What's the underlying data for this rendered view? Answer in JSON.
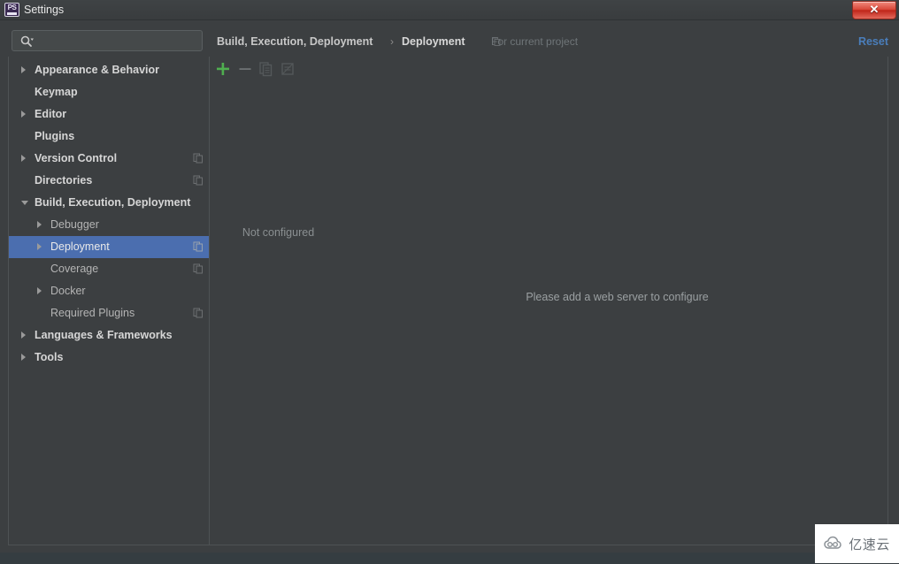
{
  "window": {
    "title": "Settings",
    "app_icon": "phpstorm-icon",
    "app_icon_text": "PS",
    "close_label": "✕"
  },
  "search": {
    "value": "",
    "placeholder": "",
    "icon": "search-icon"
  },
  "sidebar": {
    "items": [
      {
        "label": "Appearance & Behavior",
        "level": 0,
        "arrow": "right",
        "scope_icon": false,
        "selected": false
      },
      {
        "label": "Keymap",
        "level": 0,
        "arrow": "none",
        "scope_icon": false,
        "selected": false
      },
      {
        "label": "Editor",
        "level": 0,
        "arrow": "right",
        "scope_icon": false,
        "selected": false
      },
      {
        "label": "Plugins",
        "level": 0,
        "arrow": "none",
        "scope_icon": false,
        "selected": false
      },
      {
        "label": "Version Control",
        "level": 0,
        "arrow": "right",
        "scope_icon": true,
        "selected": false
      },
      {
        "label": "Directories",
        "level": 0,
        "arrow": "none",
        "scope_icon": true,
        "selected": false
      },
      {
        "label": "Build, Execution, Deployment",
        "level": 0,
        "arrow": "down",
        "scope_icon": false,
        "selected": false
      },
      {
        "label": "Debugger",
        "level": 1,
        "arrow": "right",
        "scope_icon": false,
        "selected": false
      },
      {
        "label": "Deployment",
        "level": 1,
        "arrow": "right",
        "scope_icon": true,
        "selected": true
      },
      {
        "label": "Coverage",
        "level": 1,
        "arrow": "none",
        "scope_icon": true,
        "selected": false
      },
      {
        "label": "Docker",
        "level": 1,
        "arrow": "right",
        "scope_icon": false,
        "selected": false
      },
      {
        "label": "Required Plugins",
        "level": 1,
        "arrow": "none",
        "scope_icon": true,
        "selected": false
      },
      {
        "label": "Languages & Frameworks",
        "level": 0,
        "arrow": "right",
        "scope_icon": false,
        "selected": false
      },
      {
        "label": "Tools",
        "level": 0,
        "arrow": "right",
        "scope_icon": false,
        "selected": false
      }
    ]
  },
  "header": {
    "crumb_parent": "Build, Execution, Deployment",
    "crumb_separator": "›",
    "crumb_current": "Deployment",
    "scope_note": "For current project",
    "scope_note_icon": "copy-scope-icon",
    "reset_label": "Reset"
  },
  "list_panel": {
    "toolbar": {
      "add_label": "+",
      "remove_label": "−",
      "copy_icon": "copy-icon",
      "edit_icon": "edit-document-icon"
    },
    "empty_text": "Not configured"
  },
  "detail_panel": {
    "message": "Please add a web server to configure"
  },
  "watermark": {
    "text": "亿速云",
    "logo": "cloud-logo-icon"
  },
  "colors": {
    "accent_selection": "#4b6eaf",
    "link": "#4a7ebb",
    "add_green": "#4fae4f",
    "panel_bg": "#3c3f41",
    "close_red": "#d9493b"
  }
}
